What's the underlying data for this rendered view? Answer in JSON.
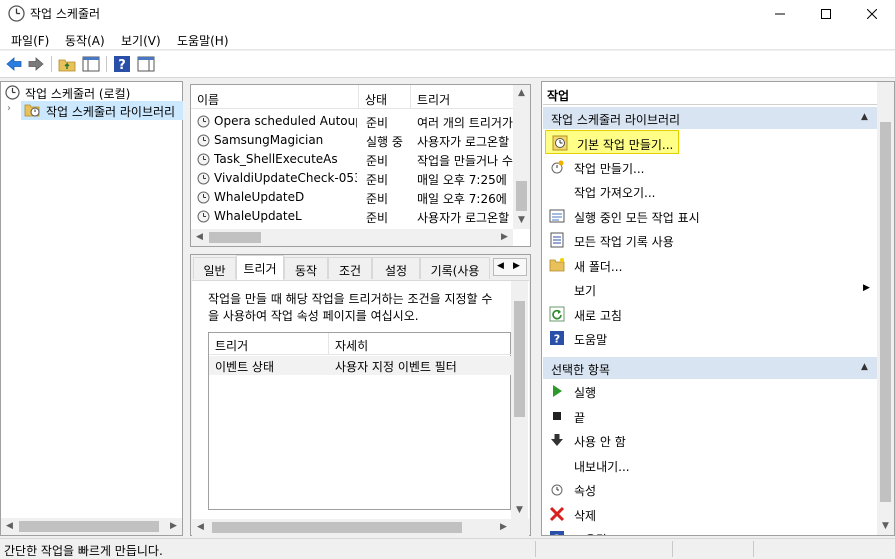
{
  "window": {
    "title": "작업 스케줄러"
  },
  "menu": [
    "파일(F)",
    "동작(A)",
    "보기(V)",
    "도움말(H)"
  ],
  "tree": {
    "root": "작업 스케줄러 (로컬)",
    "child": "작업 스케줄러 라이브러리"
  },
  "task_list": {
    "columns": [
      "이름",
      "상태",
      "트리거"
    ],
    "rows": [
      {
        "name": "Opera scheduled Autoup...",
        "status": "준비",
        "trigger": "여러 개의 트리거가"
      },
      {
        "name": "SamsungMagician",
        "status": "실행 중",
        "trigger": "사용자가 로그온할"
      },
      {
        "name": "Task_ShellExecuteAs",
        "status": "준비",
        "trigger": "작업을 만들거나 수"
      },
      {
        "name": "VivaldiUpdateCheck-053...",
        "status": "준비",
        "trigger": "매일 오후 7:25에"
      },
      {
        "name": "WhaleUpdateD",
        "status": "준비",
        "trigger": "매일 오후 7:26에"
      },
      {
        "name": "WhaleUpdateL",
        "status": "준비",
        "trigger": "사용자가 로그온할"
      }
    ]
  },
  "details": {
    "tabs": [
      "일반",
      "트리거",
      "동작",
      "조건",
      "설정",
      "기록(사용"
    ],
    "active_tab": "트리거",
    "description": [
      "작업을 만들 때 해당 작업을 트리거하는 조건을 지정할 수",
      "을 사용하여 작업 속성 페이지를 여십시오."
    ],
    "trigger_columns": [
      "트리거",
      "자세히"
    ],
    "trigger_rows": [
      {
        "trigger": "이벤트 상태",
        "detail": "사용자 지정 이벤트 필터"
      }
    ]
  },
  "actions": {
    "header": "작업",
    "section1": {
      "title": "작업 스케줄러 라이브러리",
      "items": [
        {
          "label": "기본 작업 만들기...",
          "icon": "basic-task-icon"
        },
        {
          "label": "작업 만들기...",
          "icon": "create-task-icon"
        },
        {
          "label": "작업 가져오기...",
          "icon": ""
        },
        {
          "label": "실행 중인 모든 작업 표시",
          "icon": "running-tasks-icon"
        },
        {
          "label": "모든 작업 기록 사용",
          "icon": "history-icon"
        },
        {
          "label": "새 폴더...",
          "icon": "folder-icon"
        },
        {
          "label": "보기",
          "icon": ""
        },
        {
          "label": "새로 고침",
          "icon": "refresh-icon"
        },
        {
          "label": "도움말",
          "icon": "help-icon"
        }
      ]
    },
    "section2": {
      "title": "선택한 항목",
      "items": [
        {
          "label": "실행",
          "icon": "run-icon"
        },
        {
          "label": "끝",
          "icon": "end-icon"
        },
        {
          "label": "사용 안 함",
          "icon": "disable-icon"
        },
        {
          "label": "내보내기...",
          "icon": ""
        },
        {
          "label": "속성",
          "icon": "properties-icon"
        },
        {
          "label": "삭제",
          "icon": "delete-icon"
        },
        {
          "label": "도움말",
          "icon": "help-icon"
        }
      ]
    }
  },
  "status": "간단한 작업을 빠르게 만듭니다.",
  "colors": {
    "highlight": "#ffff88",
    "highlight_border": "#e0d000",
    "section_bg": "#d9e4f2"
  }
}
